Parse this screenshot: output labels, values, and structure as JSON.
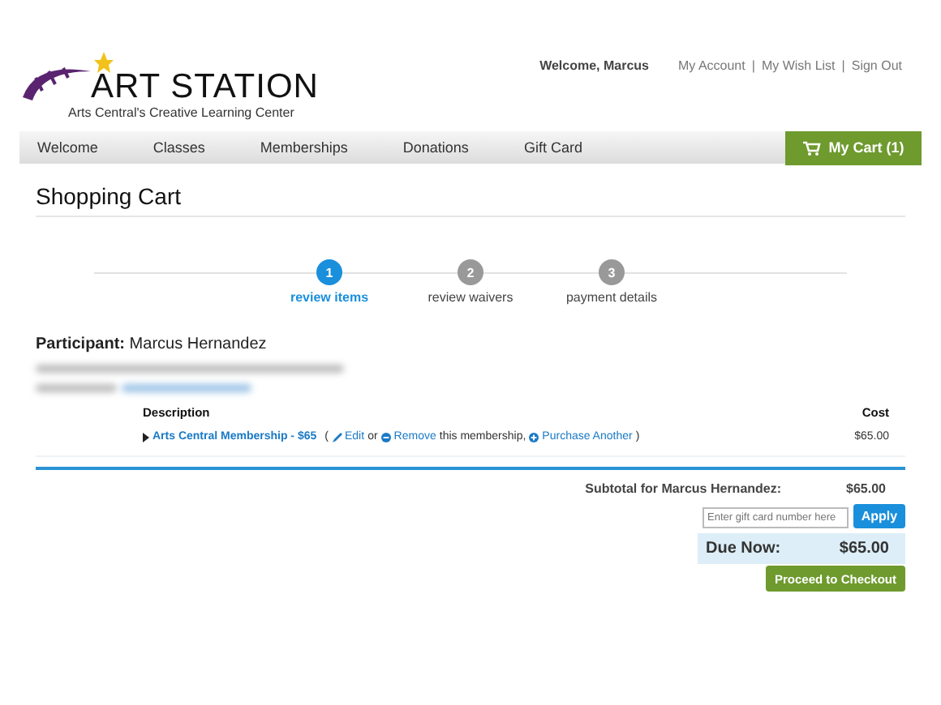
{
  "logo": {
    "title": "ART STATION",
    "subtitle": "Arts Central's Creative Learning Center"
  },
  "user_bar": {
    "welcome": "Welcome, Marcus",
    "links": [
      "My Account",
      "My Wish List",
      "Sign Out"
    ],
    "separator": "|"
  },
  "nav": {
    "items": [
      {
        "label": "Welcome"
      },
      {
        "label": "Classes"
      },
      {
        "label": "Memberships"
      },
      {
        "label": "Donations"
      },
      {
        "label": "Gift Card"
      }
    ],
    "cart": "My Cart (1)"
  },
  "page_title": "Shopping Cart",
  "steps": [
    {
      "number": "1",
      "label": "review items",
      "selected": true
    },
    {
      "number": "2",
      "label": "review waivers",
      "selected": false
    },
    {
      "number": "3",
      "label": "payment details",
      "selected": false
    }
  ],
  "participant": {
    "label": "Participant:",
    "name": "Marcus Hernandez"
  },
  "table": {
    "columns": [
      "Description",
      "Cost"
    ],
    "rows": [
      {
        "item": "Arts Central Membership - $65",
        "open": "(",
        "close": ")",
        "edit": "Edit",
        "or": "or",
        "remove": "Remove",
        "middle": "this membership,",
        "another": "Purchase Another",
        "cost": "$65.00"
      }
    ]
  },
  "summary": {
    "subtotal_label": "Subtotal for Marcus Hernandez:",
    "subtotal": "$65.00",
    "gift_placeholder": "Enter gift card number here",
    "apply": "Apply",
    "due_label": "Due Now:",
    "due": "$65.00",
    "checkout": "Proceed to Checkout"
  }
}
